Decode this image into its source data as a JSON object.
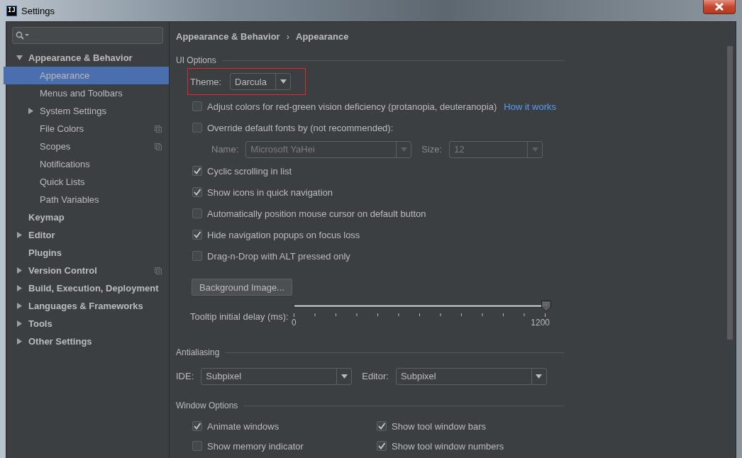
{
  "window": {
    "title": "Settings",
    "logo": "IJ"
  },
  "tree": [
    {
      "label": "Appearance & Behavior",
      "kind": "folder",
      "expanded": true,
      "selected": false,
      "children": [
        {
          "label": "Appearance",
          "kind": "page",
          "selected": true,
          "per_project": false
        },
        {
          "label": "Menus and Toolbars",
          "kind": "page",
          "selected": false,
          "per_project": false
        },
        {
          "label": "System Settings",
          "kind": "folder",
          "expanded": false,
          "selected": false,
          "per_project": false
        },
        {
          "label": "File Colors",
          "kind": "page",
          "selected": false,
          "per_project": true
        },
        {
          "label": "Scopes",
          "kind": "page",
          "selected": false,
          "per_project": true
        },
        {
          "label": "Notifications",
          "kind": "page",
          "selected": false,
          "per_project": false
        },
        {
          "label": "Quick Lists",
          "kind": "page",
          "selected": false,
          "per_project": false
        },
        {
          "label": "Path Variables",
          "kind": "page",
          "selected": false,
          "per_project": false
        }
      ]
    },
    {
      "label": "Keymap",
      "kind": "page",
      "selected": false,
      "per_project": false
    },
    {
      "label": "Editor",
      "kind": "folder",
      "expanded": false,
      "selected": false,
      "per_project": false
    },
    {
      "label": "Plugins",
      "kind": "page",
      "selected": false,
      "per_project": false
    },
    {
      "label": "Version Control",
      "kind": "folder",
      "expanded": false,
      "selected": false,
      "per_project": true
    },
    {
      "label": "Build, Execution, Deployment",
      "kind": "folder",
      "expanded": false,
      "selected": false,
      "per_project": false
    },
    {
      "label": "Languages & Frameworks",
      "kind": "folder",
      "expanded": false,
      "selected": false,
      "per_project": false
    },
    {
      "label": "Tools",
      "kind": "folder",
      "expanded": false,
      "selected": false,
      "per_project": false
    },
    {
      "label": "Other Settings",
      "kind": "folder",
      "expanded": false,
      "selected": false,
      "per_project": false
    }
  ],
  "breadcrumb": {
    "items": [
      "Appearance & Behavior",
      "Appearance"
    ],
    "separator": "›"
  },
  "sections": [
    {
      "title": "UI Options",
      "rows": [
        {
          "kind": "combo",
          "label": "Theme:",
          "value": "Darcula",
          "highlighted": true
        },
        {
          "kind": "checkbox",
          "label": "Adjust colors for red-green vision deficiency (protanopia, deuteranopia)",
          "checked": false,
          "link": "How it works"
        },
        {
          "kind": "checkbox",
          "label": "Override default fonts by (not recommended):",
          "checked": false
        },
        {
          "kind": "fields",
          "fields": [
            {
              "label": "Name:",
              "value": "Microsoft YaHei",
              "disabled": true
            },
            {
              "label": "Size:",
              "value": "12",
              "disabled": true
            }
          ]
        },
        {
          "kind": "checkbox",
          "label": "Cyclic scrolling in list",
          "checked": true
        },
        {
          "kind": "checkbox",
          "label": "Show icons in quick navigation",
          "checked": true
        },
        {
          "kind": "checkbox",
          "label": "Automatically position mouse cursor on default button",
          "checked": false
        },
        {
          "kind": "checkbox",
          "label": "Hide navigation popups on focus loss",
          "checked": true
        },
        {
          "kind": "checkbox",
          "label": "Drag-n-Drop with ALT pressed only",
          "checked": false
        },
        {
          "kind": "button",
          "label": "Background Image..."
        },
        {
          "kind": "slider",
          "label": "Tooltip initial delay (ms):",
          "level": 1,
          "min_label": "0",
          "max_label": "1200"
        }
      ]
    },
    {
      "title": "Antialiasing",
      "rows": [
        {
          "kind": "fields",
          "fields": [
            {
              "label": "IDE:",
              "value": "Subpixel",
              "disabled": false
            },
            {
              "label": "Editor:",
              "value": "Subpixel",
              "disabled": false
            }
          ]
        }
      ]
    },
    {
      "title": "Window Options",
      "rows": [
        {
          "kind": "checkgrid",
          "items": [
            {
              "label": "Animate windows",
              "checked": true
            },
            {
              "label": "Show tool window bars",
              "checked": true
            },
            {
              "label": "Show memory indicator",
              "checked": false
            },
            {
              "label": "Show tool window numbers",
              "checked": true
            }
          ]
        }
      ]
    }
  ]
}
